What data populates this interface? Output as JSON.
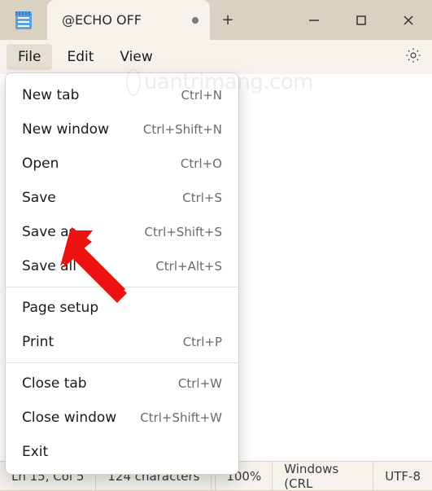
{
  "tab": {
    "title": "@ECHO OFF"
  },
  "menubar": {
    "file": "File",
    "edit": "Edit",
    "view": "View"
  },
  "file_menu": {
    "new_tab": {
      "label": "New tab",
      "shortcut": "Ctrl+N"
    },
    "new_window": {
      "label": "New window",
      "shortcut": "Ctrl+Shift+N"
    },
    "open": {
      "label": "Open",
      "shortcut": "Ctrl+O"
    },
    "save": {
      "label": "Save",
      "shortcut": "Ctrl+S"
    },
    "save_as": {
      "label": "Save as",
      "shortcut": "Ctrl+Shift+S"
    },
    "save_all": {
      "label": "Save all",
      "shortcut": "Ctrl+Alt+S"
    },
    "page_setup": {
      "label": "Page setup",
      "shortcut": ""
    },
    "print": {
      "label": "Print",
      "shortcut": "Ctrl+P"
    },
    "close_tab": {
      "label": "Close tab",
      "shortcut": "Ctrl+W"
    },
    "close_window": {
      "label": "Close window",
      "shortcut": "Ctrl+Shift+W"
    },
    "exit": {
      "label": "Exit",
      "shortcut": ""
    }
  },
  "statusbar": {
    "position": "Ln 15, Col 5",
    "charcount": "124 characters",
    "zoom": "100%",
    "lineend": "Windows (CRL",
    "encoding": "UTF-8"
  },
  "watermark_text": "uantrimang.com"
}
